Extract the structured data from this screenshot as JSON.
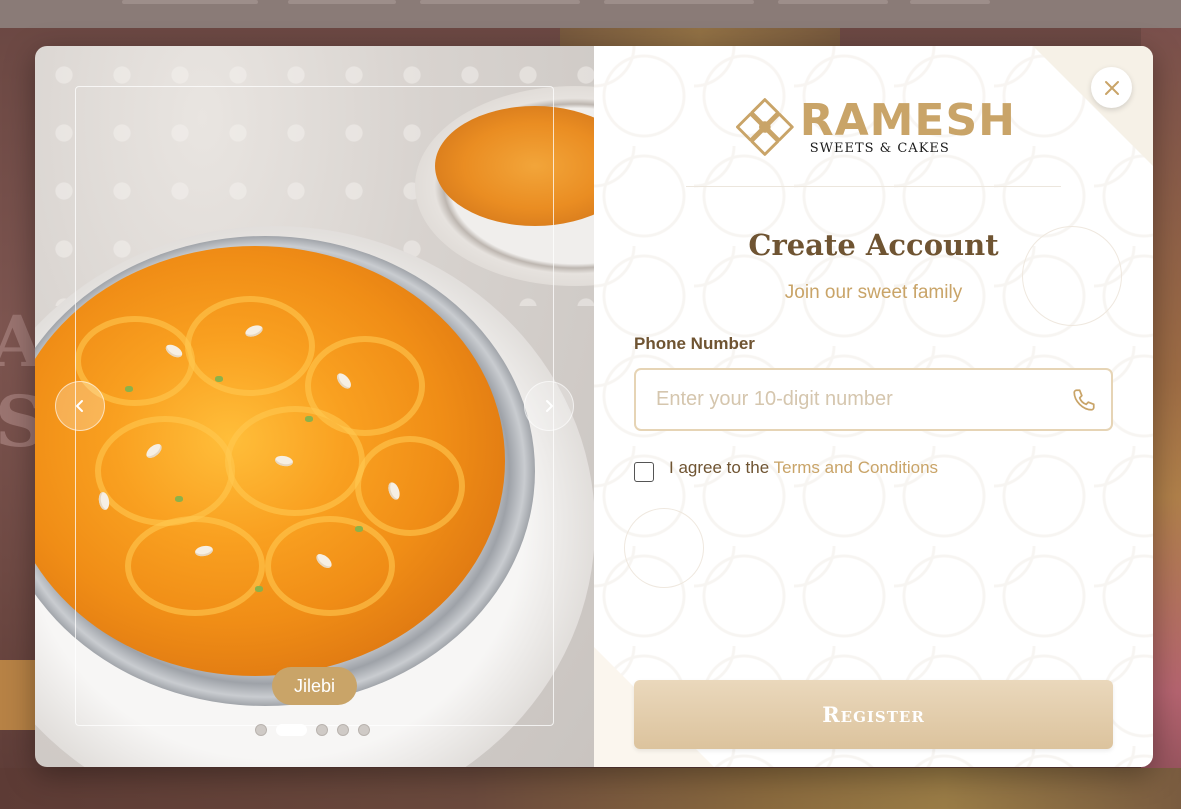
{
  "brand": {
    "name": "RAMESH",
    "tagline": "SWEETS & CAKES",
    "accent_color": "#c9a468"
  },
  "carousel": {
    "caption": "Jilebi",
    "slide_count": 5,
    "active_index": 1,
    "prev_icon": "chevron-left-icon",
    "next_icon": "chevron-right-icon"
  },
  "form": {
    "title": "Create Account",
    "subtitle": "Join our sweet family",
    "phone_label": "Phone Number",
    "phone_placeholder": "Enter your 10-digit number",
    "phone_value": "",
    "phone_icon": "phone-icon",
    "agree_text": "I agree to the ",
    "terms_link": "Terms and Conditions",
    "agree_checked": false,
    "register_label": "Register",
    "close_icon": "close-icon"
  }
}
